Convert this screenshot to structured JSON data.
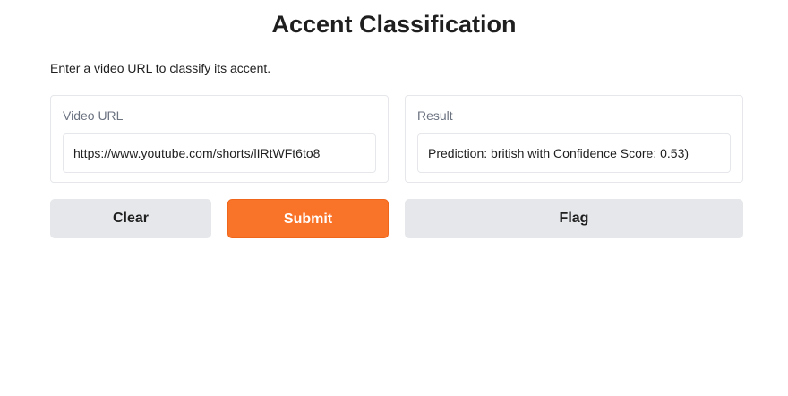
{
  "header": {
    "title": "Accent Classification",
    "description": "Enter a video URL to classify its accent."
  },
  "input_panel": {
    "label": "Video URL",
    "value": "https://www.youtube.com/shorts/lIRtWFt6to8"
  },
  "output_panel": {
    "label": "Result",
    "value": "Prediction: british with Confidence Score: 0.53)"
  },
  "actions": {
    "clear_label": "Clear",
    "submit_label": "Submit",
    "flag_label": "Flag"
  },
  "colors": {
    "accent": "#f97328",
    "secondary_button": "#e5e7eb",
    "border": "#e5e7eb"
  }
}
